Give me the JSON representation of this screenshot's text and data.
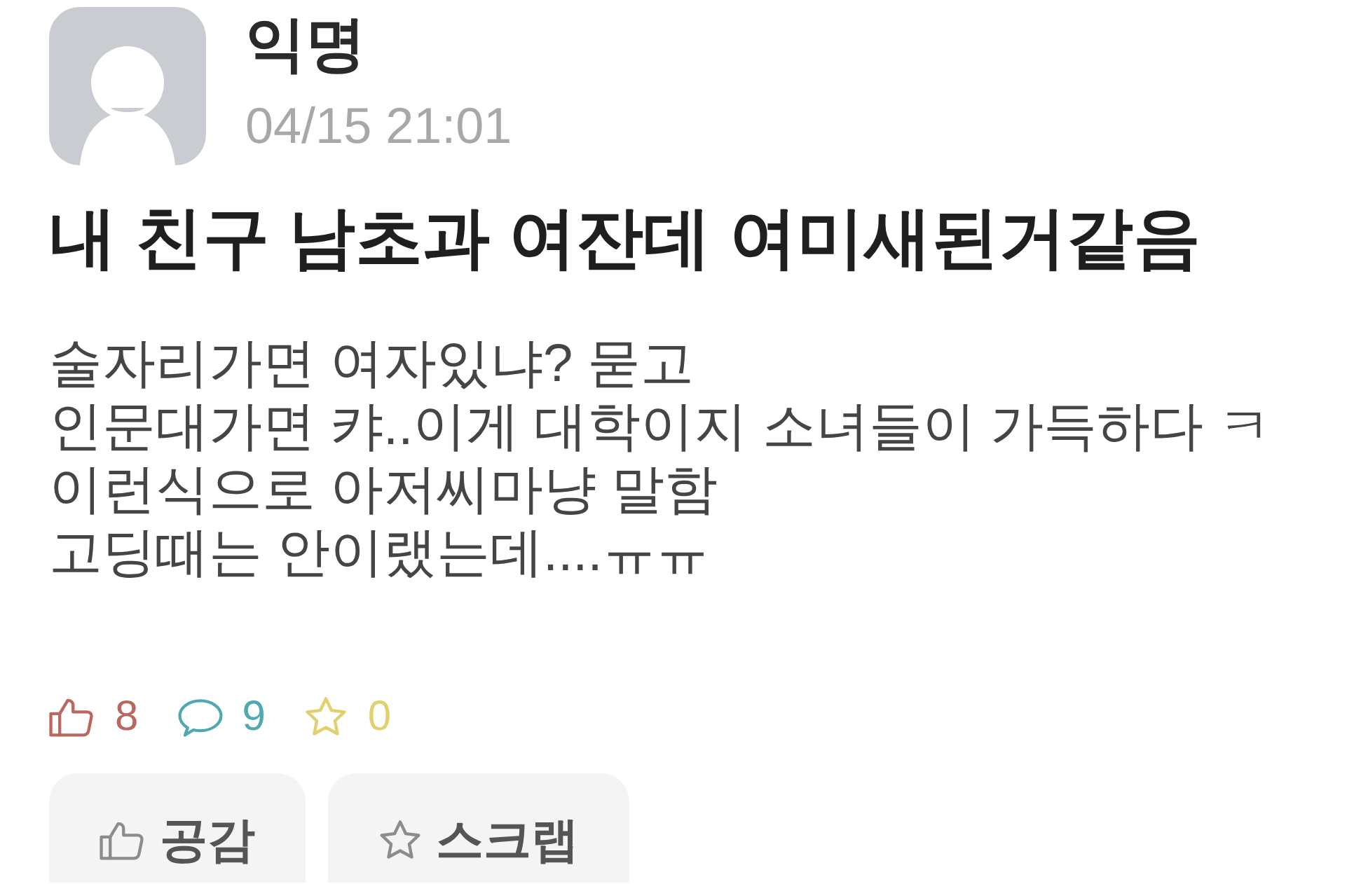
{
  "post": {
    "author": "익명",
    "timestamp": "04/15 21:01",
    "title": "내 친구 남초과 여잔데 여미새된거같음",
    "body": [
      "술자리가면 여자있냐? 묻고",
      "인문대가면 캬..이게 대학이지 소녀들이 가득하다 ㅋ",
      "이런식으로 아저씨마냥 말함",
      "고딩때는 안이랬는데....ㅠㅠ"
    ]
  },
  "stats": [
    {
      "kind": "like",
      "count": "8",
      "color": "#b8685e"
    },
    {
      "kind": "comment",
      "count": "9",
      "color": "#4fa8b2"
    },
    {
      "kind": "scrap",
      "count": "0",
      "color": "#e2d06e"
    }
  ],
  "actions": [
    {
      "kind": "like",
      "label": "공감"
    },
    {
      "kind": "scrap",
      "label": "스크랩"
    }
  ]
}
